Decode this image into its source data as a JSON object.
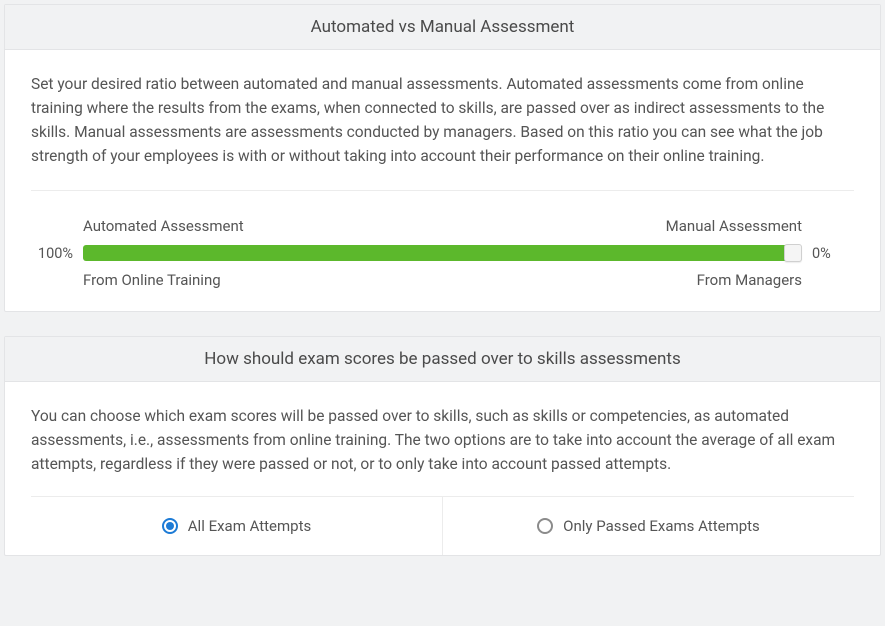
{
  "panel1": {
    "title": "Automated vs Manual Assessment",
    "description": "Set your desired ratio between automated and manual assessments. Automated assessments come from online training where the results from the exams, when connected to skills, are passed over as indirect assessments to the skills. Manual assessments are assessments conducted by managers. Based on this ratio you can see what the job strength of your employees is with or without taking into account their performance on their online training.",
    "slider": {
      "leftPercent": "100%",
      "rightPercent": "0%",
      "topLeftLabel": "Automated Assessment",
      "topRightLabel": "Manual Assessment",
      "bottomLeftLabel": "From Online Training",
      "bottomRightLabel": "From Managers"
    }
  },
  "panel2": {
    "title": "How should exam scores be passed over to skills assessments",
    "description": "You can choose which exam scores will be passed over to skills, such as skills or competencies, as automated assessments, i.e., assessments from online training. The two options are to take into account the average of all exam attempts, regardless if they were passed or not, or to only take into account passed attempts.",
    "options": {
      "allAttempts": "All Exam Attempts",
      "onlyPassed": "Only Passed Exams Attempts",
      "selected": "allAttempts"
    }
  }
}
